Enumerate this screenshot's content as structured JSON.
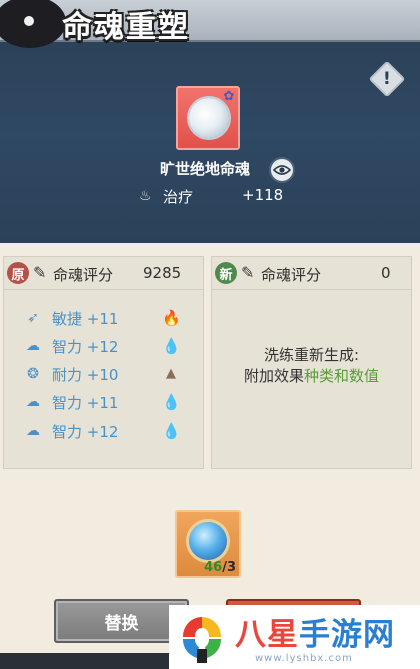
{
  "header": {
    "title": "命魂重塑",
    "help_icon": "help-icon"
  },
  "item": {
    "name": "旷世绝地命魂",
    "stat_label": "治疗",
    "stat_value": "+118"
  },
  "original": {
    "tag": "原",
    "score_label": "命魂评分",
    "score_value": "9285",
    "attributes": [
      {
        "label": "敏捷 +11",
        "icon": "agility-icon",
        "element": "fire-icon"
      },
      {
        "label": "智力 +12",
        "icon": "intellect-icon",
        "element": "water-drop-icon"
      },
      {
        "label": "耐力 +10",
        "icon": "stamina-icon",
        "element": "mountain-icon"
      },
      {
        "label": "智力 +11",
        "icon": "intellect-icon",
        "element": "water-drop-icon"
      },
      {
        "label": "智力 +12",
        "icon": "intellect-icon",
        "element": "water-drop-icon"
      }
    ]
  },
  "new": {
    "tag": "新",
    "score_label": "命魂评分",
    "score_value": "0",
    "note_line1": "洗练重新生成:",
    "note_line2_prefix": "附加效果",
    "note_line2_highlight": "种类和数值"
  },
  "material": {
    "have": "46",
    "need": "/3"
  },
  "buttons": {
    "replace": "替换"
  },
  "watermark": {
    "brand_1": "八星",
    "brand_2": "手游网",
    "url": "www.lyshbx.com"
  },
  "colors": {
    "accent_blue": "#4a92c6",
    "accent_green": "#5a9c3a",
    "banner": "#2f4863"
  }
}
